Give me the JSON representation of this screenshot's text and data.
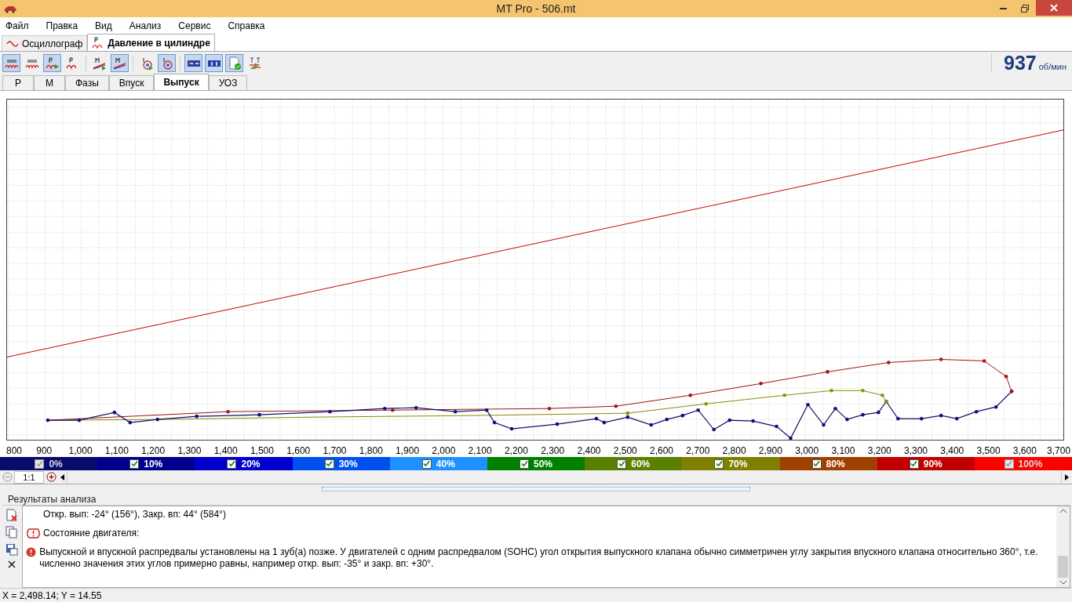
{
  "window": {
    "title": "MT Pro - 506.mt"
  },
  "menu": [
    "Файл",
    "Правка",
    "Вид",
    "Анализ",
    "Сервис",
    "Справка"
  ],
  "tabs": [
    {
      "label": "Осциллограф",
      "selected": false,
      "kind": "wave"
    },
    {
      "label": "Давление в цилиндре",
      "selected": true,
      "kind": "pressure"
    }
  ],
  "toolbar": [
    {
      "buttons": [
        {
          "kind": "scope",
          "pressed": true
        },
        {
          "kind": "scope",
          "pressed": false
        },
        {
          "kind": "pressure-play",
          "pressed": true
        },
        {
          "kind": "pressure",
          "pressed": false
        }
      ]
    },
    {
      "buttons": [
        {
          "kind": "m-play",
          "pressed": false
        },
        {
          "kind": "m-slope",
          "pressed": true
        }
      ]
    },
    {
      "buttons": [
        {
          "kind": "target-play",
          "pressed": false
        },
        {
          "kind": "target",
          "pressed": true
        }
      ]
    },
    {
      "buttons": [
        {
          "kind": "arrows-h",
          "pressed": true
        },
        {
          "kind": "arrows-v",
          "pressed": true
        },
        {
          "kind": "doc-check",
          "pressed": true
        },
        {
          "kind": "cross-arrows",
          "pressed": false
        }
      ]
    }
  ],
  "rpm": {
    "value": "937",
    "unit": "об/мин"
  },
  "subtabs": [
    {
      "label": "Р",
      "selected": false
    },
    {
      "label": "М",
      "selected": false
    },
    {
      "label": "Фазы",
      "selected": false
    },
    {
      "label": "Впуск",
      "selected": false
    },
    {
      "label": "Выпуск",
      "selected": true
    },
    {
      "label": "УОЗ",
      "selected": false
    }
  ],
  "x_axis_labels": [
    "800",
    "900",
    "1,000",
    "1,100",
    "1,200",
    "1,300",
    "1,400",
    "1,500",
    "1,600",
    "1,700",
    "1,800",
    "1,900",
    "2,000",
    "2,100",
    "2,200",
    "2,300",
    "2,400",
    "2,500",
    "2,600",
    "2,700",
    "2,800",
    "2,900",
    "3,000",
    "3,100",
    "3,200",
    "3,300",
    "3,400",
    "3,500",
    "3,600",
    "3,700"
  ],
  "legend": [
    {
      "label": "0%",
      "color": "#0a0a6e",
      "checked": true,
      "disabled": true
    },
    {
      "label": "10%",
      "color": "#00008c",
      "checked": true,
      "disabled": false
    },
    {
      "label": "20%",
      "color": "#0000cc",
      "checked": true,
      "disabled": false
    },
    {
      "label": "30%",
      "color": "#0050f0",
      "checked": true,
      "disabled": false
    },
    {
      "label": "40%",
      "color": "#1e90ff",
      "checked": true,
      "disabled": false
    },
    {
      "label": "50%",
      "color": "#008000",
      "checked": true,
      "disabled": false
    },
    {
      "label": "60%",
      "color": "#5a8000",
      "checked": true,
      "disabled": false
    },
    {
      "label": "70%",
      "color": "#808000",
      "checked": true,
      "disabled": false
    },
    {
      "label": "80%",
      "color": "#a04000",
      "checked": true,
      "disabled": false
    },
    {
      "label": "90%",
      "color": "#c00000",
      "checked": true,
      "disabled": false
    },
    {
      "label": "100%",
      "color": "#ff0000",
      "checked": true,
      "disabled": true
    }
  ],
  "zoom": {
    "ratio": "1:1"
  },
  "results": {
    "title": "Результаты анализа",
    "lines": [
      {
        "kind": "plain",
        "text": "Откр. вып: -24° (156°), Закр. вп: 44° (584°)"
      },
      {
        "kind": "engine",
        "text": "Состояние двигателя:"
      },
      {
        "kind": "error",
        "text": "Выпускной и впускной распредвалы установлены на 1 зуб(а) позже. У двигателей с одним распредвалом (SOHC) угол открытия выпускного клапана обычно симметричен углу закрытия впускного клапана относительно 360°, т.е. численно значения этих углов примерно равны, например откр. вып: -35° и закр. вп: +30°."
      }
    ]
  },
  "status_bar": "X = 2,498.14; Y = 14.55"
}
